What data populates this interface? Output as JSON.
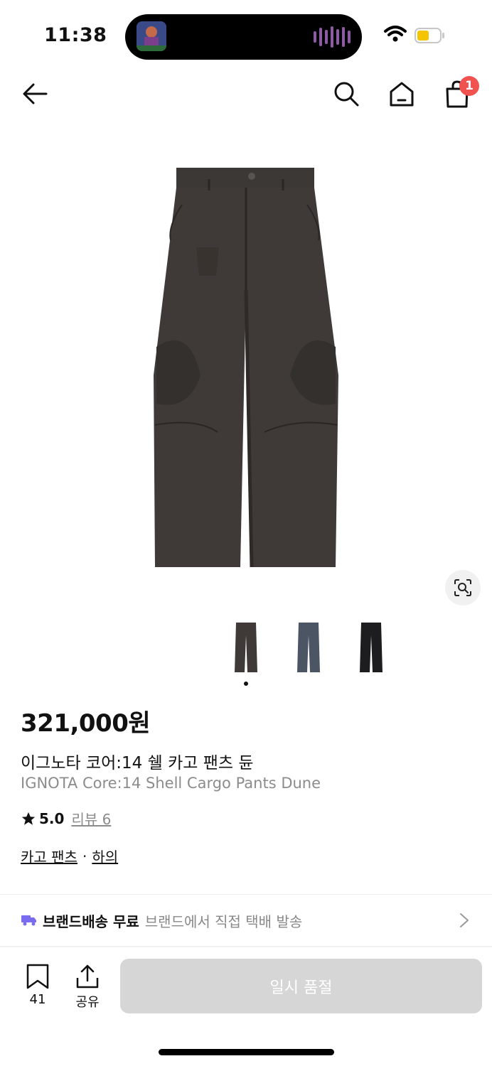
{
  "status_bar": {
    "time": "11:38",
    "icons": [
      "now-playing-artwork",
      "audio-waveform-icon",
      "wifi-icon",
      "battery-icon"
    ],
    "battery_color": "#f5c400"
  },
  "nav": {
    "icons": [
      "back-arrow-icon",
      "search-icon",
      "home-icon",
      "shopping-bag-icon"
    ],
    "cart_badge": "1",
    "badge_color": "#f0524f"
  },
  "product": {
    "image_icon": "cargo-pants-photo",
    "swatches": [
      "dune",
      "blue",
      "black"
    ],
    "price": "321,000원",
    "name_ko": "이그노타 코어:14 쉘 카고 팬츠 듄",
    "name_en": "IGNOTA Core:14 Shell Cargo Pants Dune",
    "rating": "5.0",
    "review_label": "리뷰 6",
    "categories": [
      "카고 팬츠",
      "하의"
    ],
    "category_separator": "·"
  },
  "delivery": {
    "icon": "truck-icon",
    "icon_color": "#7a6cf0",
    "title": "브랜드배송 무료",
    "description": "브랜드에서 직접 택배 발송"
  },
  "bottom_bar": {
    "bookmark_count": "41",
    "share_label": "공유",
    "soldout_label": "일시 품절"
  }
}
